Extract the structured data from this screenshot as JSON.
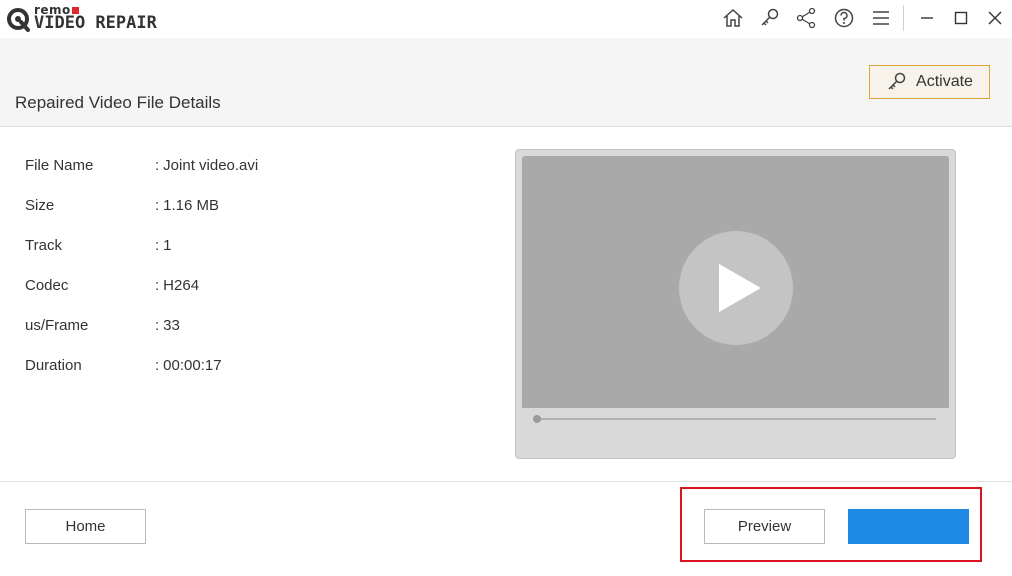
{
  "app": {
    "logo_small": "remo",
    "logo_product": "VIDEO REPAIR",
    "brand_red": "#e0262f"
  },
  "toolbar": {
    "icons": [
      "home-icon",
      "key-icon",
      "share-icon",
      "help-icon",
      "menu-icon"
    ],
    "window_controls": [
      "minimize-icon",
      "maximize-icon",
      "close-icon"
    ]
  },
  "header": {
    "title": "Repaired Video File Details",
    "activate_label": "Activate",
    "activate_border_color": "#e0a33a"
  },
  "details": {
    "rows": [
      {
        "label": "File Name",
        "value": "Joint video.avi"
      },
      {
        "label": "Size",
        "value": "1.16 MB"
      },
      {
        "label": "Track",
        "value": "1"
      },
      {
        "label": "Codec",
        "value": "H264"
      },
      {
        "label": "us/Frame",
        "value": "33"
      },
      {
        "label": "Duration",
        "value": "00:00:17"
      }
    ],
    "separator": ":"
  },
  "player": {
    "icon": "play-icon",
    "progress": 0
  },
  "footer": {
    "home_label": "Home",
    "preview_label": "Preview",
    "save_label": "",
    "accent_color": "#1e88e5",
    "highlight_color": "#d9141e"
  }
}
